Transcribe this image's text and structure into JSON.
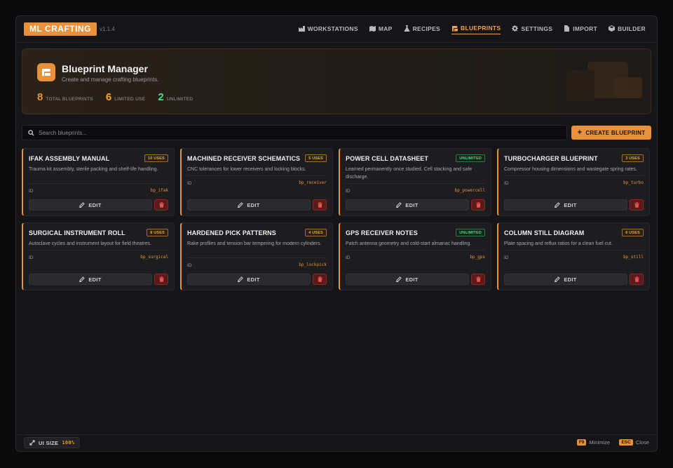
{
  "app": {
    "brand": "ML CRAFTING",
    "version": "v1.1.4"
  },
  "nav": [
    {
      "label": "WORKSTATIONS",
      "icon": "factory-icon",
      "active": false
    },
    {
      "label": "MAP",
      "icon": "map-icon",
      "active": false
    },
    {
      "label": "RECIPES",
      "icon": "flask-icon",
      "active": false
    },
    {
      "label": "BLUEPRINTS",
      "icon": "scroll-icon",
      "active": true
    },
    {
      "label": "SETTINGS",
      "icon": "gear-icon",
      "active": false
    },
    {
      "label": "IMPORT",
      "icon": "file-import-icon",
      "active": false
    },
    {
      "label": "BUILDER",
      "icon": "cube-icon",
      "active": false
    }
  ],
  "hero": {
    "title": "Blueprint Manager",
    "subtitle": "Create and manage crafting blueprints.",
    "icon": "scroll-icon",
    "stats": [
      {
        "value": "8",
        "label": "TOTAL BLUEPRINTS",
        "color": "#e8913a"
      },
      {
        "value": "6",
        "label": "LIMITED USE",
        "color": "#f0a830"
      },
      {
        "value": "2",
        "label": "UNLIMITED",
        "color": "#4ade80"
      }
    ]
  },
  "search": {
    "placeholder": "Search blueprints...",
    "value": ""
  },
  "create_button": {
    "label": "CREATE BLUEPRINT"
  },
  "card_labels": {
    "id_label": "ID",
    "edit_label": "EDIT"
  },
  "blueprints": [
    {
      "title": "IFAK ASSEMBLY MANUAL",
      "badge": "10 USES",
      "unlimited": false,
      "desc": "Trauma kit assembly, sterile packing and shelf-life handling.",
      "id": "bp_ifak"
    },
    {
      "title": "MACHINED RECEIVER SCHEMATICS",
      "badge": "5 USES",
      "unlimited": false,
      "desc": "CNC tolerances for lower receivers and locking blocks.",
      "id": "bp_receiver"
    },
    {
      "title": "POWER CELL DATASHEET",
      "badge": "UNLIMITED",
      "unlimited": true,
      "desc": "Learned permanently once studied. Cell stacking and safe discharge.",
      "id": "bp_powercell"
    },
    {
      "title": "TURBOCHARGER BLUEPRINT",
      "badge": "3 USES",
      "unlimited": false,
      "desc": "Compressor housing dimensions and wastegate spring rates.",
      "id": "bp_turbo"
    },
    {
      "title": "SURGICAL INSTRUMENT ROLL",
      "badge": "8 USES",
      "unlimited": false,
      "desc": "Autoclave cycles and instrument layout for field theatres.",
      "id": "bp_surgical"
    },
    {
      "title": "HARDENED PICK PATTERNS",
      "badge": "4 USES",
      "unlimited": false,
      "desc": "Rake profiles and tension bar tempering for modern cylinders.",
      "id": "bp_lockpick"
    },
    {
      "title": "GPS RECEIVER NOTES",
      "badge": "UNLIMITED",
      "unlimited": true,
      "desc": "Patch antenna geometry and cold-start almanac handling.",
      "id": "bp_gps"
    },
    {
      "title": "COLUMN STILL DIAGRAM",
      "badge": "6 USES",
      "unlimited": false,
      "desc": "Plate spacing and reflux ratios for a clean fuel cut.",
      "id": "bp_still"
    }
  ],
  "footer": {
    "ui_size_label": "UI SIZE",
    "ui_size_value": "100%",
    "shortcuts": [
      {
        "key": "F9",
        "label": "Minimize"
      },
      {
        "key": "ESC",
        "label": "Close"
      }
    ]
  }
}
